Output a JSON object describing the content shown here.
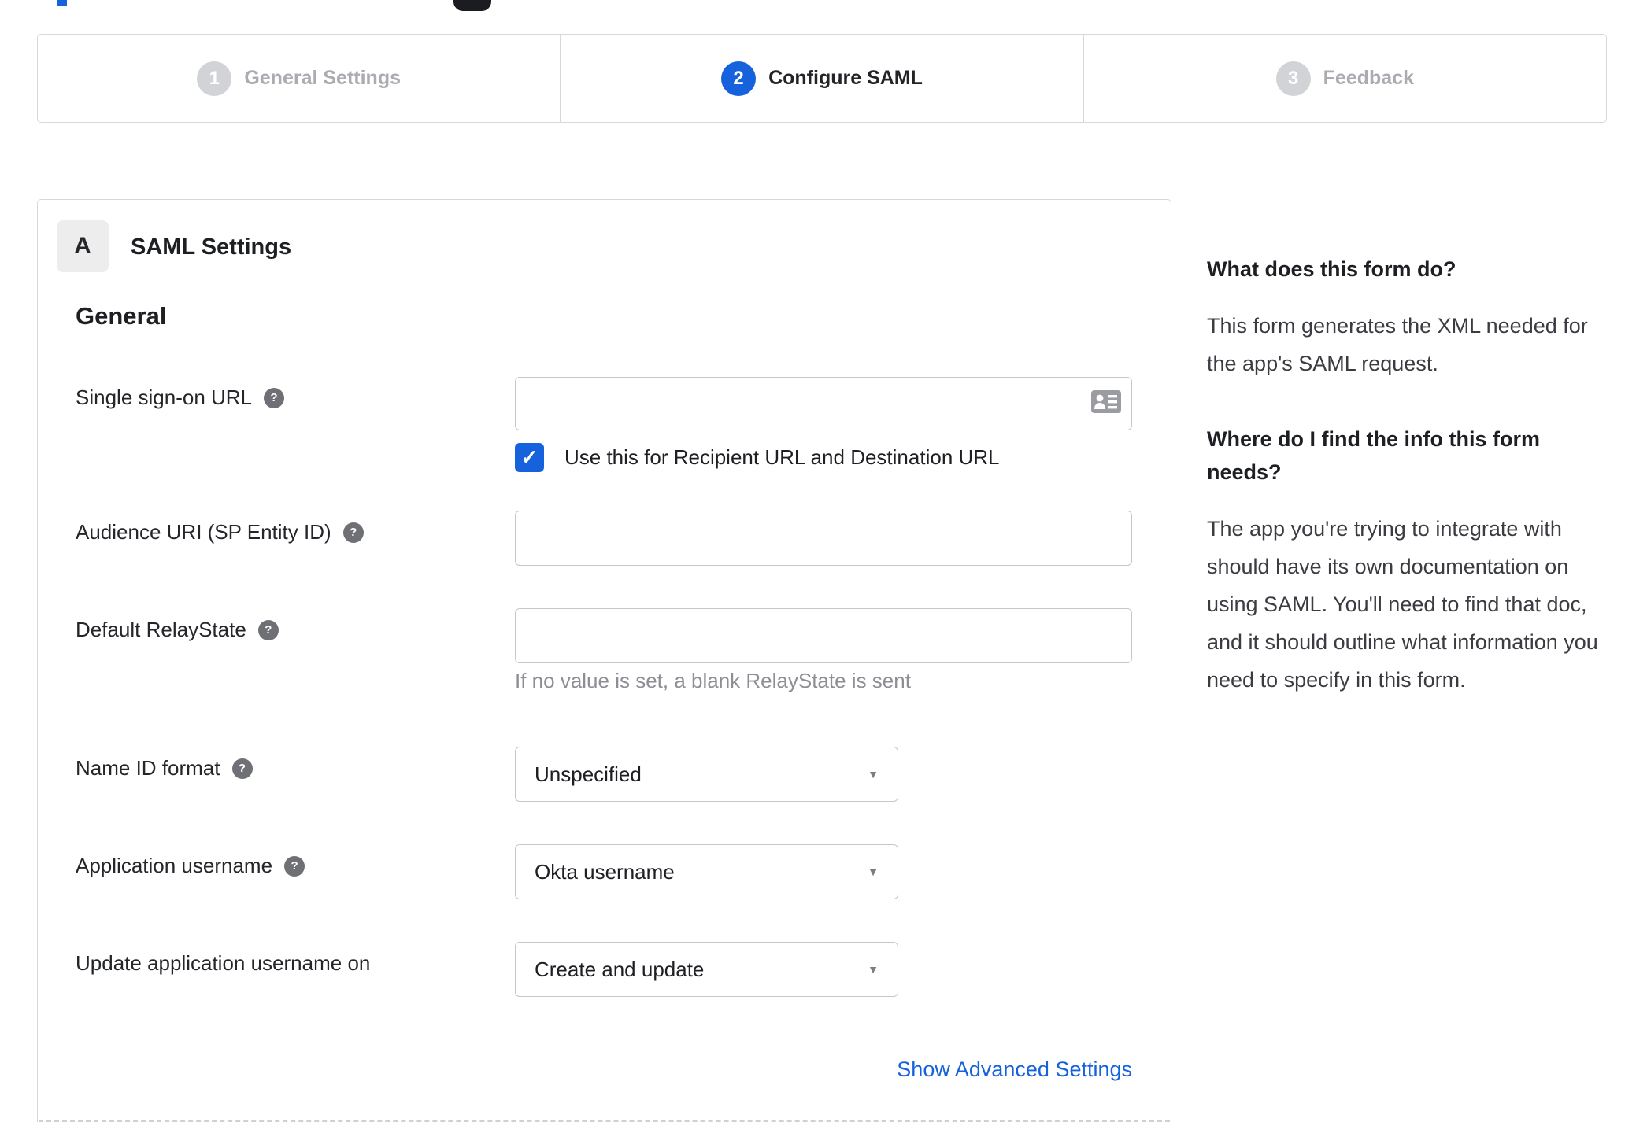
{
  "wizard": {
    "steps": [
      {
        "number": "1",
        "label": "General Settings",
        "state": "inactive"
      },
      {
        "number": "2",
        "label": "Configure SAML",
        "state": "active"
      },
      {
        "number": "3",
        "label": "Feedback",
        "state": "inactive"
      }
    ]
  },
  "panel": {
    "badge": "A",
    "title": "SAML Settings",
    "section": "General",
    "form": {
      "sso": {
        "label": "Single sign-on URL",
        "value": "",
        "checkbox_label": "Use this for Recipient URL and Destination URL",
        "checkbox_checked": true
      },
      "audience": {
        "label": "Audience URI (SP Entity ID)",
        "value": ""
      },
      "relay_state": {
        "label": "Default RelayState",
        "value": "",
        "hint": "If no value is set, a blank RelayState is sent"
      },
      "name_id_format": {
        "label": "Name ID format",
        "selected": "Unspecified"
      },
      "app_username": {
        "label": "Application username",
        "selected": "Okta username"
      },
      "update_username": {
        "label": "Update application username on",
        "selected": "Create and update"
      },
      "advanced_link": "Show Advanced Settings"
    }
  },
  "sidebar": {
    "help1_title": "What does this form do?",
    "help1_body": "This form generates the XML needed for the app's SAML request.",
    "help2_title": "Where do I find the info this form needs?",
    "help2_body": "The app you're trying to integrate with should have its own documentation on using SAML. You'll need to find that doc, and it should outline what information you need to specify in this form."
  },
  "icons": {
    "help_glyph": "?",
    "checkmark": "✓",
    "dropdown_arrow": "▼",
    "input_icon": "contact-card"
  },
  "colors": {
    "accent_blue": "#1662dd",
    "border_gray": "#d8d8dc",
    "inactive_circle": "#d2d3d7",
    "inactive_text": "#aaacb1",
    "text_dark": "#1d1f23",
    "hint_text": "#8e8f96"
  }
}
